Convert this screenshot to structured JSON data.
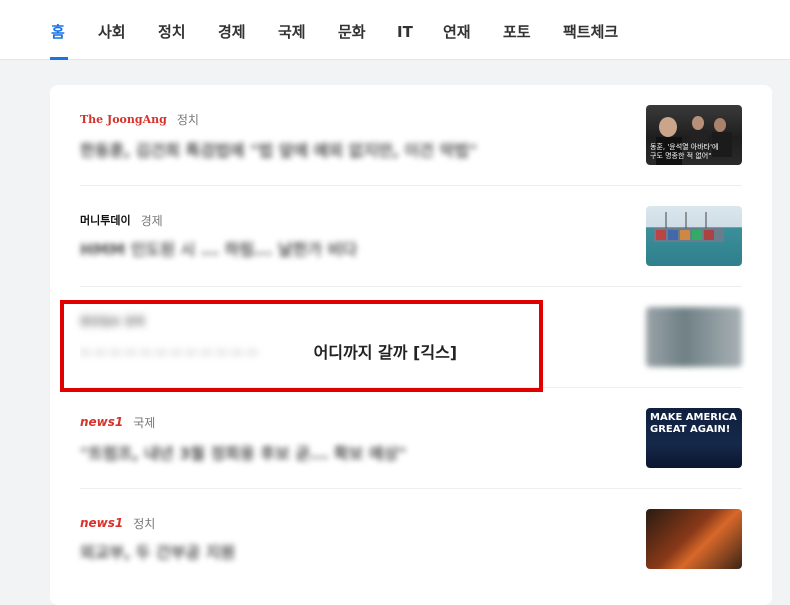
{
  "tabs": [
    {
      "label": "홈",
      "active": true
    },
    {
      "label": "사회"
    },
    {
      "label": "정치"
    },
    {
      "label": "경제"
    },
    {
      "label": "국제"
    },
    {
      "label": "문화"
    },
    {
      "label": "IT"
    },
    {
      "label": "연재"
    },
    {
      "label": "포토"
    },
    {
      "label": "팩트체크"
    }
  ],
  "articles": [
    {
      "press": "The JoongAng",
      "section": "정치",
      "headline": "한동훈, 김건희 특검법에 \"법 앞에 예외 없지만, 이건 악법\"",
      "thumb_caption_1": "동훈, '윤석열 아바타'에",
      "thumb_caption_2": "구도 명종한 적 없어\""
    },
    {
      "press": "머니투데이",
      "section": "경제",
      "headline": "HMM 인도된 시 ... 하림... 날한가 비다"
    },
    {
      "press": "",
      "section": "",
      "headline": "어디까지 갈까 [긱스]"
    },
    {
      "press": "news1",
      "section": "국제",
      "headline": "\"트럼프, 내년 3월 정회용 후보 곧... 확보 예상\"",
      "thumb_caption_1": "MAKE AMERICA",
      "thumb_caption_2": "GREAT AGAIN!"
    },
    {
      "press": "news1",
      "section": "정치",
      "headline": "외교부, 두 간부공 지원"
    }
  ],
  "colors": {
    "accent": "#1a73e8",
    "highlight": "#e10000"
  }
}
